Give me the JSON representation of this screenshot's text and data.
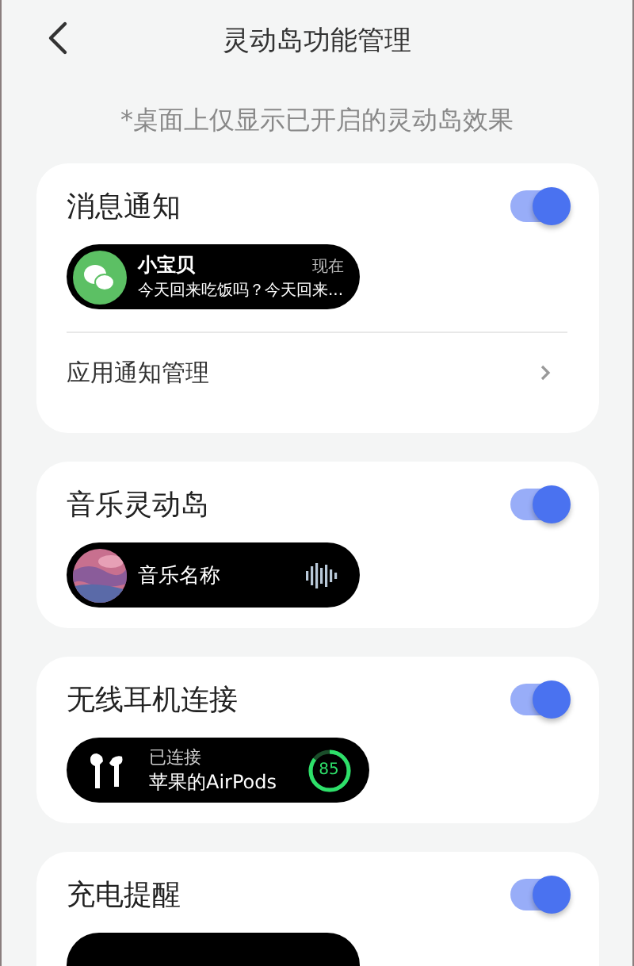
{
  "header": {
    "title": "灵动岛功能管理"
  },
  "note": "*桌面上仅显示已开启的灵动岛效果",
  "sections": [
    {
      "kind": "message",
      "title": "消息通知",
      "on": true,
      "island": {
        "name": "小宝贝",
        "time": "现在",
        "message": "今天回来吃饭吗？今天回来..."
      },
      "link": "应用通知管理"
    },
    {
      "kind": "music",
      "title": "音乐灵动岛",
      "on": true,
      "island": {
        "track": "音乐名称"
      }
    },
    {
      "kind": "earbuds",
      "title": "无线耳机连接",
      "on": true,
      "island": {
        "status": "已连接",
        "device": "苹果的AirPods",
        "battery": "85",
        "level": 0.85
      }
    },
    {
      "kind": "charging",
      "title": "充电提醒",
      "on": true
    }
  ]
}
